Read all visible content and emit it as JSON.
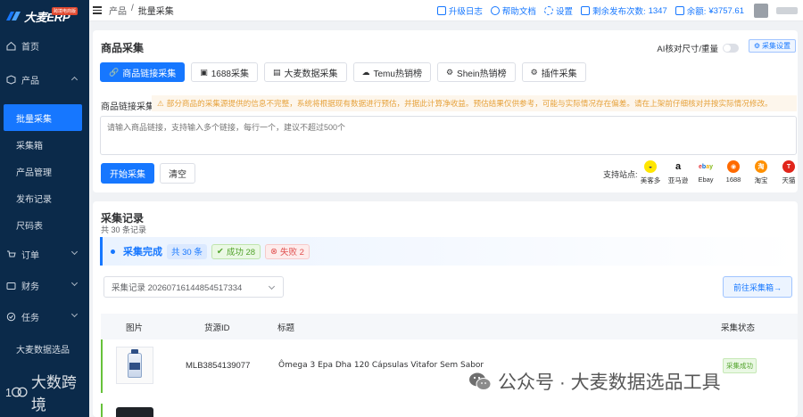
{
  "app": {
    "logo_text": "大麦ERP",
    "logo_badge": "跨境电商版"
  },
  "sidebar": {
    "items": [
      {
        "label": "首页",
        "icon": "home-icon",
        "type": "item"
      },
      {
        "label": "产品",
        "icon": "box-icon",
        "type": "group",
        "expanded": true
      },
      {
        "label": "批量采集",
        "type": "sub",
        "active": true
      },
      {
        "label": "采集箱",
        "type": "sub"
      },
      {
        "label": "产品管理",
        "type": "sub"
      },
      {
        "label": "发布记录",
        "type": "sub"
      },
      {
        "label": "尺码表",
        "type": "sub"
      },
      {
        "label": "订单",
        "icon": "cart-icon",
        "type": "group"
      },
      {
        "label": "财务",
        "icon": "wallet-icon",
        "type": "group"
      },
      {
        "label": "任务",
        "icon": "task-icon",
        "type": "group"
      },
      {
        "label": "大麦数据选品",
        "type": "sub"
      }
    ],
    "watermark": "大数跨境"
  },
  "header": {
    "breadcrumb": [
      "产品",
      "批量采集"
    ],
    "separator": "/",
    "links": {
      "changelog": "升级日志",
      "help": "帮助文档",
      "settings": "设置",
      "remaining_label": "剩余发布次数:",
      "remaining_value": "1347",
      "balance_label": "余额:",
      "balance_value": "¥3757.61"
    }
  },
  "collect": {
    "title": "商品采集",
    "ai_toggle_label": "AI核对尺寸/重量",
    "ai_toggle_on": false,
    "settings_button": "采集设置",
    "tabs": [
      {
        "label": "商品链接采集",
        "icon": "link-icon",
        "active": true
      },
      {
        "label": "1688采集",
        "icon": "store-icon"
      },
      {
        "label": "大麦数据采集",
        "icon": "database-icon"
      },
      {
        "label": "Temu热销榜",
        "icon": "cloud-icon"
      },
      {
        "label": "Shein热销榜",
        "icon": "gear-icon"
      },
      {
        "label": "插件采集",
        "icon": "plugin-icon"
      }
    ],
    "link_label": "商品链接采集",
    "notice": "部分商品的采集源提供的信息不完整，系统将根据现有数据进行预估，并据此计算净收益。预估结果仅供参考，可能与实际情况存在偏差。请在上架前仔细核对并按实际情况修改。",
    "textarea_placeholder": "请输入商品链接，支持输入多个链接，每行一个，建议不超过500个",
    "start_button": "开始采集",
    "clear_button": "清空",
    "sites_label": "支持站点:",
    "sites": [
      {
        "name": "美客多",
        "color": "#ffe600",
        "glyph": "◒"
      },
      {
        "name": "亚马逊",
        "color": "#ffffff",
        "glyph": "a"
      },
      {
        "name": "Ebay",
        "color": "#ffffff",
        "glyph": "ebay"
      },
      {
        "name": "1688",
        "color": "#ff6a00",
        "glyph": "◉"
      },
      {
        "name": "淘宝",
        "color": "#ff9000",
        "glyph": "淘"
      },
      {
        "name": "天猫",
        "color": "#e1251b",
        "glyph": "T"
      }
    ]
  },
  "records": {
    "title": "采集记录",
    "count_text": "共 30 条记录",
    "status": {
      "text": "采集完成",
      "total": "共 30 条",
      "success": "成功 28",
      "failed": "失败 2"
    },
    "select_value": "采集记录 20260716144854517334",
    "goto_button": "前往采集箱→",
    "columns": [
      "图片",
      "货源ID",
      "标题",
      "采集状态"
    ],
    "rows": [
      {
        "id": "MLB3854139077",
        "title": "Ômega 3 Epa Dha 120 Cápsulas Vitafor Sem Sabor",
        "status": "采集成功"
      }
    ]
  },
  "watermark_right": "公众号 · 大麦数据选品工具"
}
